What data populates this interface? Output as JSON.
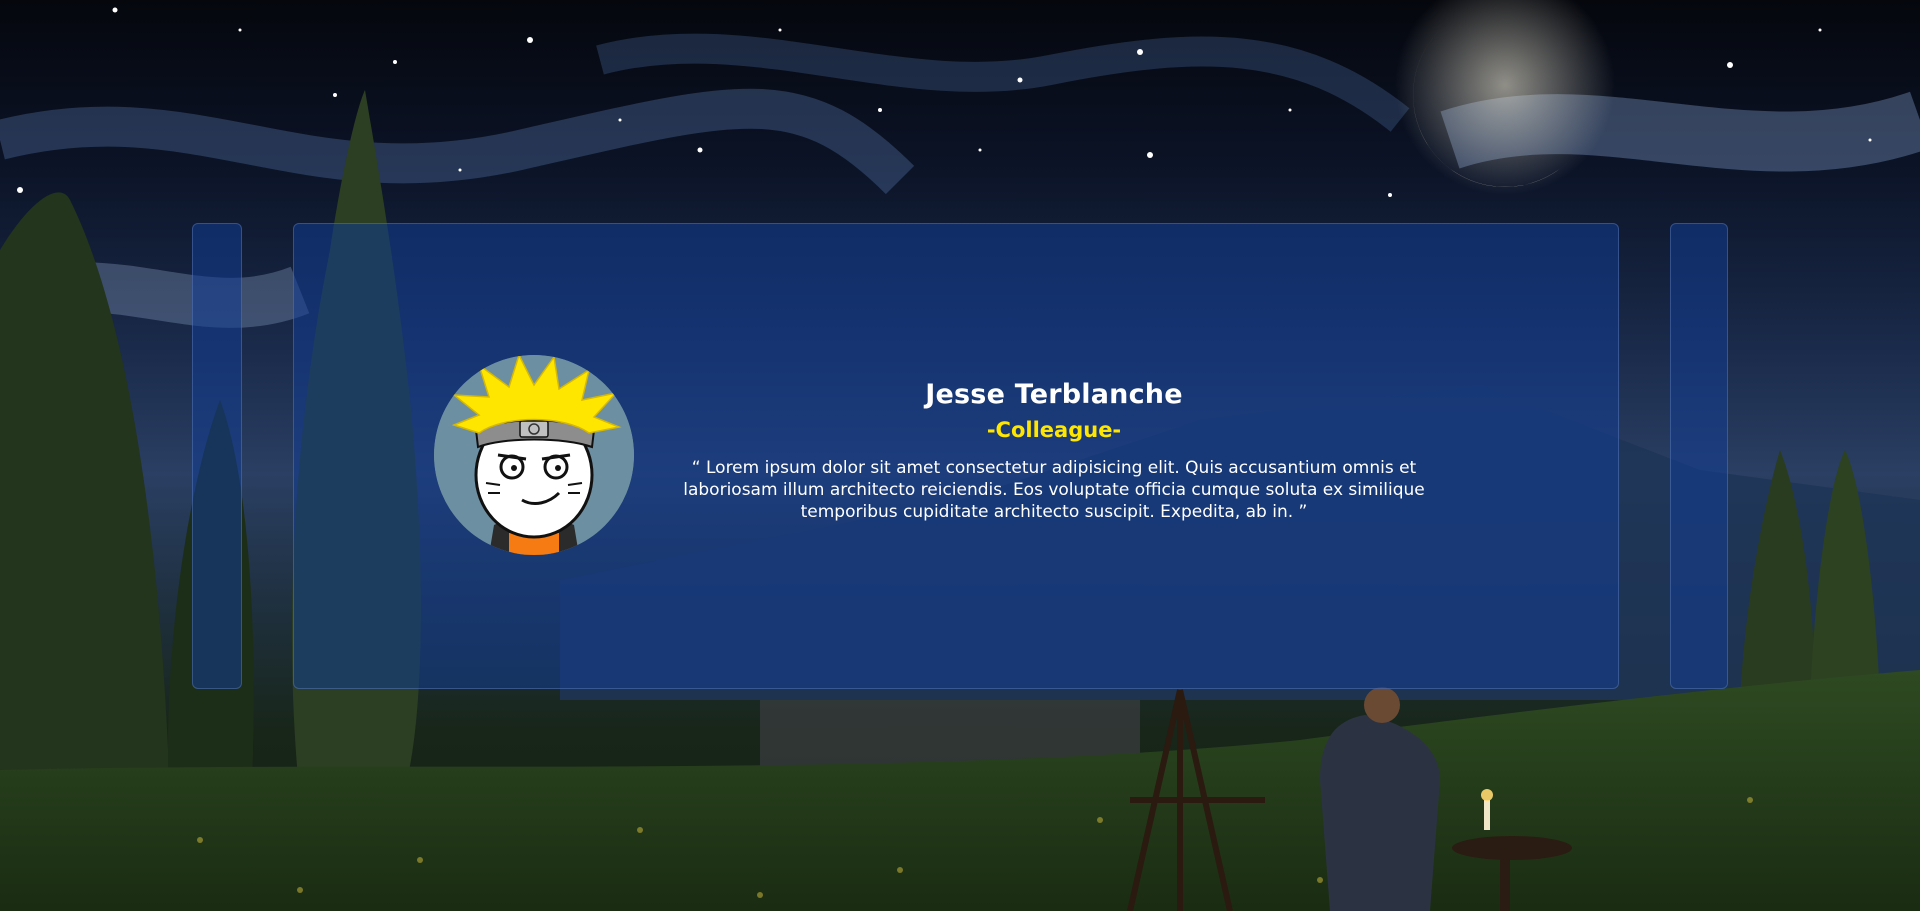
{
  "testimonial": {
    "name": "Jesse Terblanche",
    "role": "-Colleague-",
    "quote": "“ Lorem ipsum dolor sit amet consectetur adipisicing elit. Quis accusantium omnis et laboriosam illum architecto reiciendis. Eos voluptate officia cumque soluta ex similique temporibus cupiditate architecto suscipit. Expedita, ab in. ”"
  },
  "avatar": {
    "icon": "cartoon-ninja-avatar"
  },
  "colors": {
    "card": "#133c91",
    "role": "#ffe600",
    "text": "#ffffff"
  }
}
